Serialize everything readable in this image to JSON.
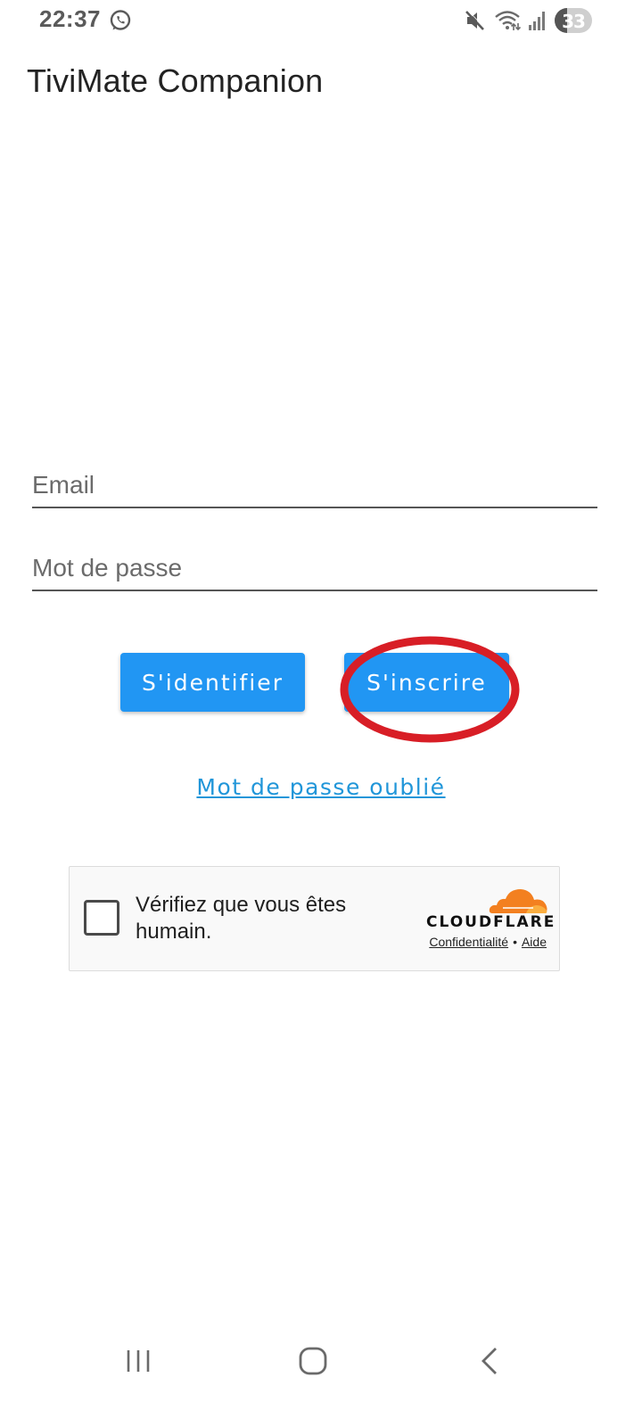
{
  "status_bar": {
    "time": "22:37",
    "battery_level": "33",
    "battery_percent": 33,
    "icons": [
      "whatsapp-icon",
      "mute-icon",
      "wifi-icon",
      "signal-icon",
      "battery-icon"
    ]
  },
  "app": {
    "title": "TiviMate Companion"
  },
  "form": {
    "email_placeholder": "Email",
    "email_value": "",
    "password_placeholder": "Mot de passe",
    "password_value": "",
    "login_label": "S'identifier",
    "register_label": "S'inscrire",
    "forgot_label": "Mot de passe oublié"
  },
  "captcha": {
    "label": "Vérifiez que vous êtes humain.",
    "checked": false,
    "brand": "CLOUDFLARE",
    "privacy_label": "Confidentialité",
    "separator": "•",
    "help_label": "Aide"
  },
  "colors": {
    "primary": "#2196f3",
    "link": "#2196d9",
    "annotation": "#d81e26",
    "cloudflare_orange": "#f38020"
  },
  "nav": {
    "icons": [
      "recents-icon",
      "home-icon",
      "back-icon"
    ]
  }
}
